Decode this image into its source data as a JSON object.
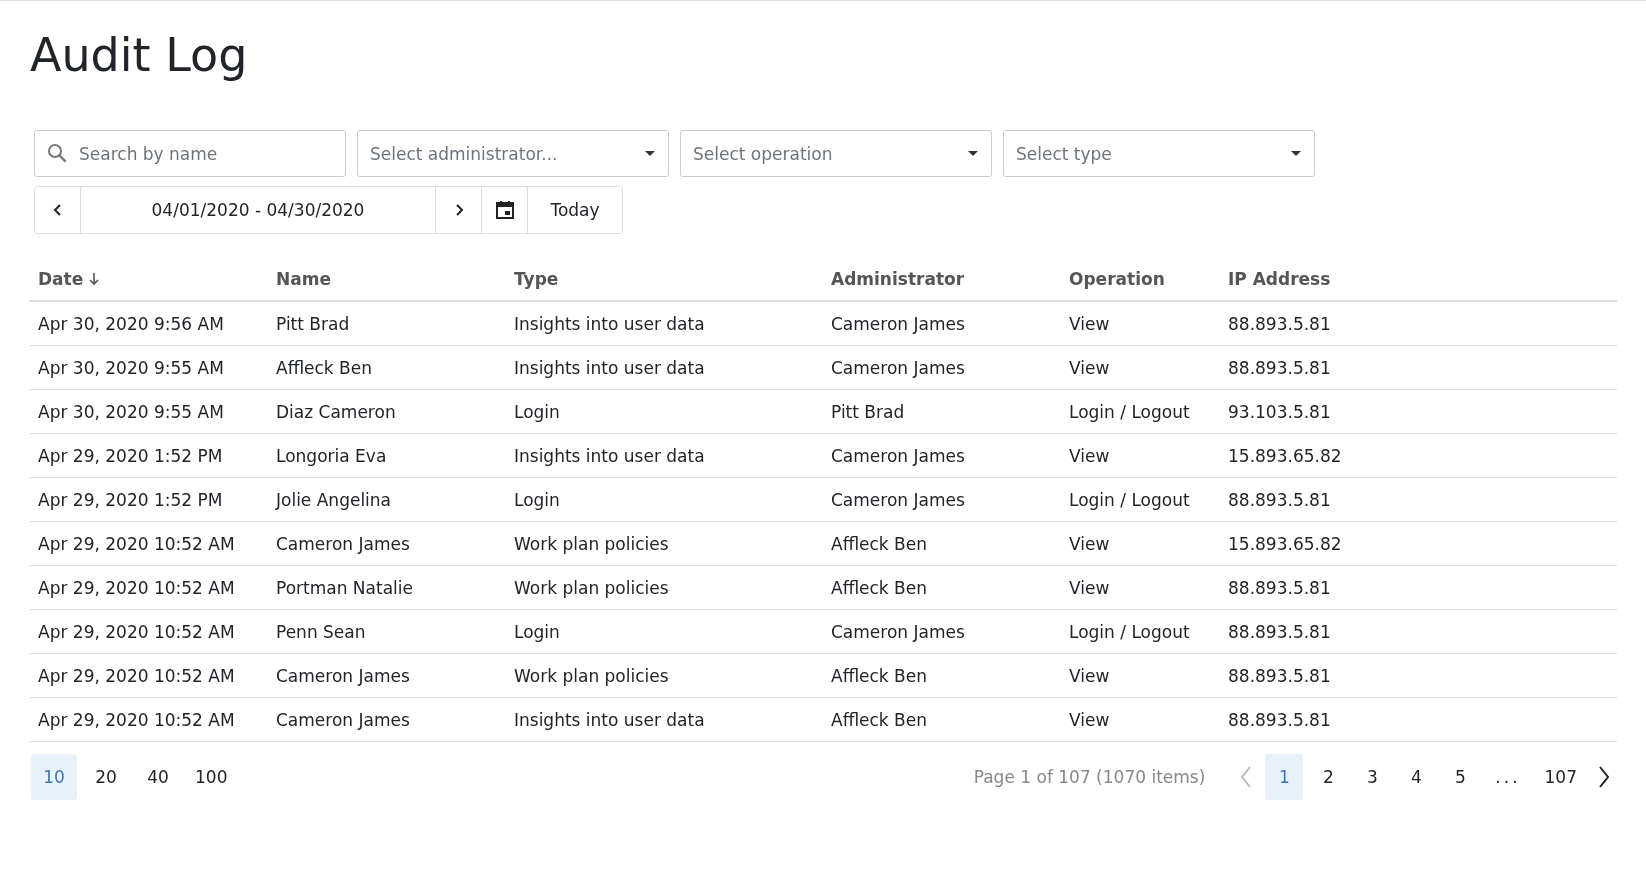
{
  "title": "Audit Log",
  "filters": {
    "search": {
      "placeholder": "Search by name"
    },
    "selects": [
      {
        "placeholder": "Select administrator..."
      },
      {
        "placeholder": "Select operation"
      },
      {
        "placeholder": "Select type"
      }
    ]
  },
  "date_range": {
    "value": "04/01/2020 - 04/30/2020",
    "today": "Today"
  },
  "table": {
    "columns": [
      {
        "label": "Date",
        "sorted_descending": true
      },
      {
        "label": "Name",
        "sorted_descending": false
      },
      {
        "label": "Type",
        "sorted_descending": false
      },
      {
        "label": "Administrator",
        "sorted_descending": false
      },
      {
        "label": "Operation",
        "sorted_descending": false
      },
      {
        "label": "IP Address",
        "sorted_descending": false
      }
    ],
    "rows": [
      [
        "Apr 30, 2020 9:56 AM",
        "Pitt Brad",
        "Insights into user data",
        "Cameron James",
        "View",
        "88.893.5.81"
      ],
      [
        "Apr 30, 2020 9:55 AM",
        "Affleck Ben",
        "Insights into user data",
        "Cameron James",
        "View",
        "88.893.5.81"
      ],
      [
        "Apr 30, 2020 9:55 AM",
        "Diaz Cameron",
        "Login",
        "Pitt Brad",
        "Login / Logout",
        "93.103.5.81"
      ],
      [
        "Apr 29, 2020 1:52 PM",
        "Longoria Eva",
        "Insights into user data",
        "Cameron James",
        "View",
        "15.893.65.82"
      ],
      [
        "Apr 29, 2020 1:52 PM",
        "Jolie Angelina",
        "Login",
        "Cameron James",
        "Login / Logout",
        "88.893.5.81"
      ],
      [
        "Apr 29, 2020 10:52 AM",
        "Cameron James",
        "Work plan policies",
        "Affleck Ben",
        "View",
        "15.893.65.82"
      ],
      [
        "Apr 29, 2020 10:52 AM",
        "Portman Natalie",
        "Work plan policies",
        "Affleck Ben",
        "View",
        "88.893.5.81"
      ],
      [
        "Apr 29, 2020 10:52 AM",
        "Penn Sean",
        "Login",
        "Cameron James",
        "Login / Logout",
        "88.893.5.81"
      ],
      [
        "Apr 29, 2020 10:52 AM",
        "Cameron James",
        "Work plan policies",
        "Affleck Ben",
        "View",
        "88.893.5.81"
      ],
      [
        "Apr 29, 2020 10:52 AM",
        "Cameron James",
        "Insights into user data",
        "Affleck Ben",
        "View",
        "88.893.5.81"
      ]
    ]
  },
  "pager": {
    "page_sizes": [
      {
        "label": "10",
        "selected": true
      },
      {
        "label": "20",
        "selected": false
      },
      {
        "label": "40",
        "selected": false
      },
      {
        "label": "100",
        "selected": false
      }
    ],
    "summary": "Page 1 of 107 (1070 items)",
    "prev_disabled": true,
    "next_disabled": false,
    "pages": [
      {
        "kind": "page",
        "label": "1",
        "selected": true
      },
      {
        "kind": "page",
        "label": "2",
        "selected": false
      },
      {
        "kind": "page",
        "label": "3",
        "selected": false
      },
      {
        "kind": "page",
        "label": "4",
        "selected": false
      },
      {
        "kind": "page",
        "label": "5",
        "selected": false
      },
      {
        "kind": "ellipsis",
        "label": "..."
      },
      {
        "kind": "page",
        "label": "107",
        "selected": false
      }
    ]
  }
}
